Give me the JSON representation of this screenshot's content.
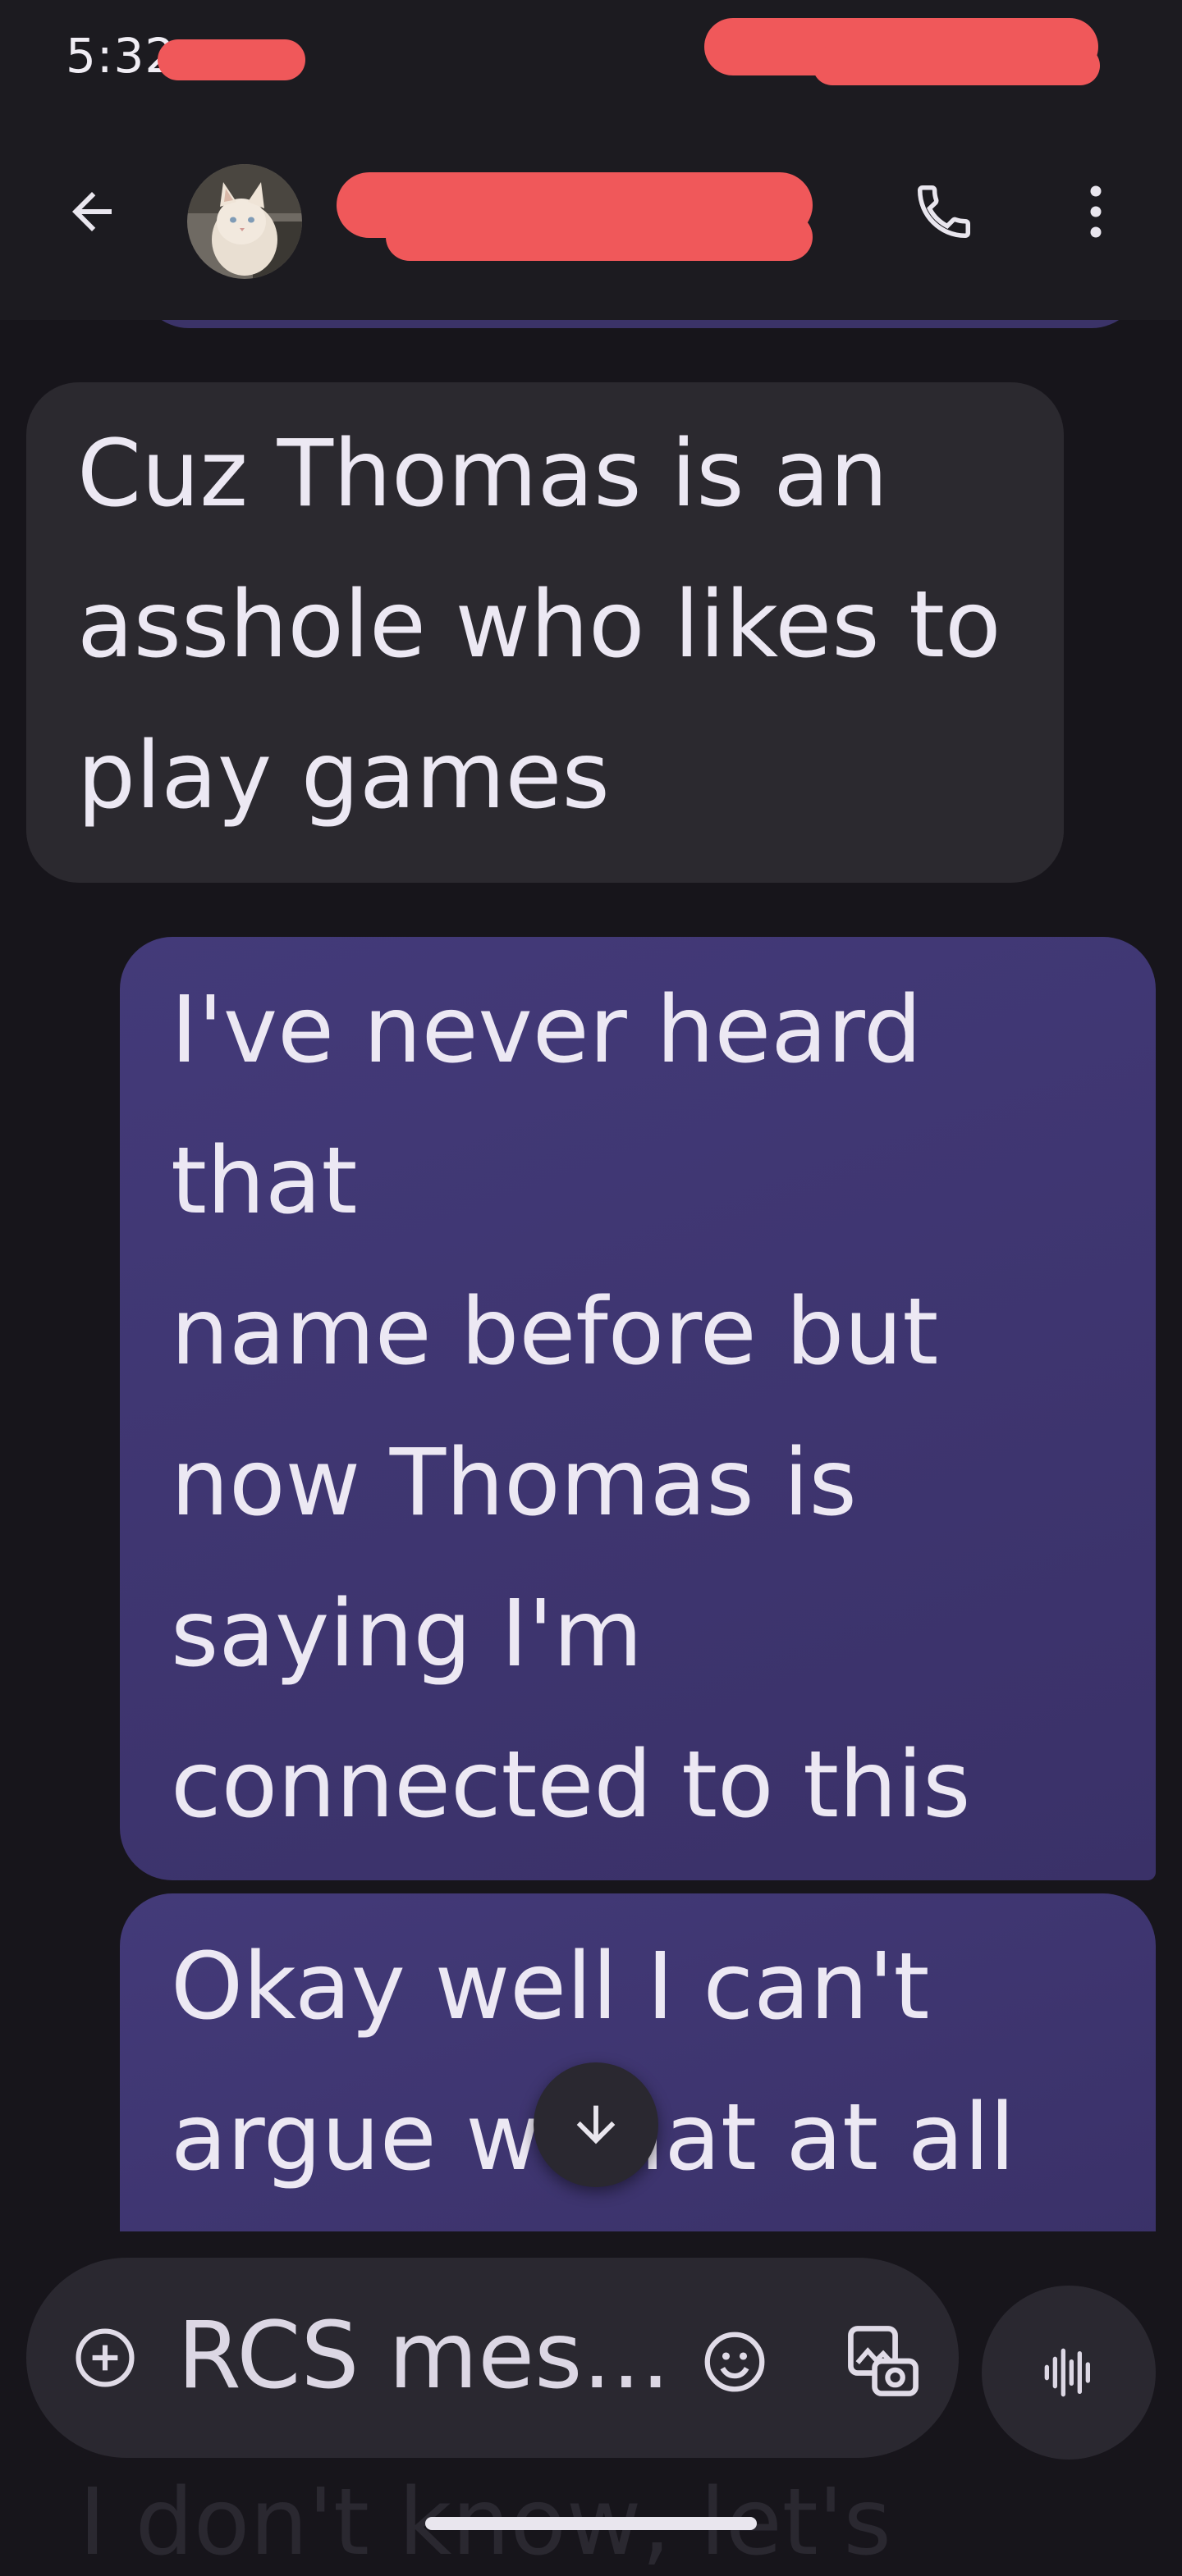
{
  "status_bar": {
    "time": "5:32"
  },
  "conversation": {
    "composer_placeholder": "RCS mes..."
  },
  "messages": [
    {
      "direction": "received",
      "text": "Cuz Thomas is an\nasshole who likes to\nplay games"
    },
    {
      "direction": "sent",
      "text": "I've never heard that\nname before but\nnow Thomas is\nsaying I'm\nconnected to this\nperson"
    },
    {
      "direction": "sent",
      "text": "Okay well I can't\nargue w that at all"
    }
  ],
  "ghost_text": "I don't know, let's",
  "icons": {
    "back": "arrow-back-icon",
    "call": "phone-icon",
    "more": "more-vert-icon",
    "scroll": "arrow-down-icon",
    "add": "add-circle-icon",
    "emoji": "emoji-icon",
    "gallery": "gallery-icon",
    "voice": "voice-waveform-icon"
  },
  "colors": {
    "background": "#17151b",
    "received_bubble": "#2b292f",
    "sent_bubble": "#3e366f",
    "redaction": "#f0585a"
  }
}
